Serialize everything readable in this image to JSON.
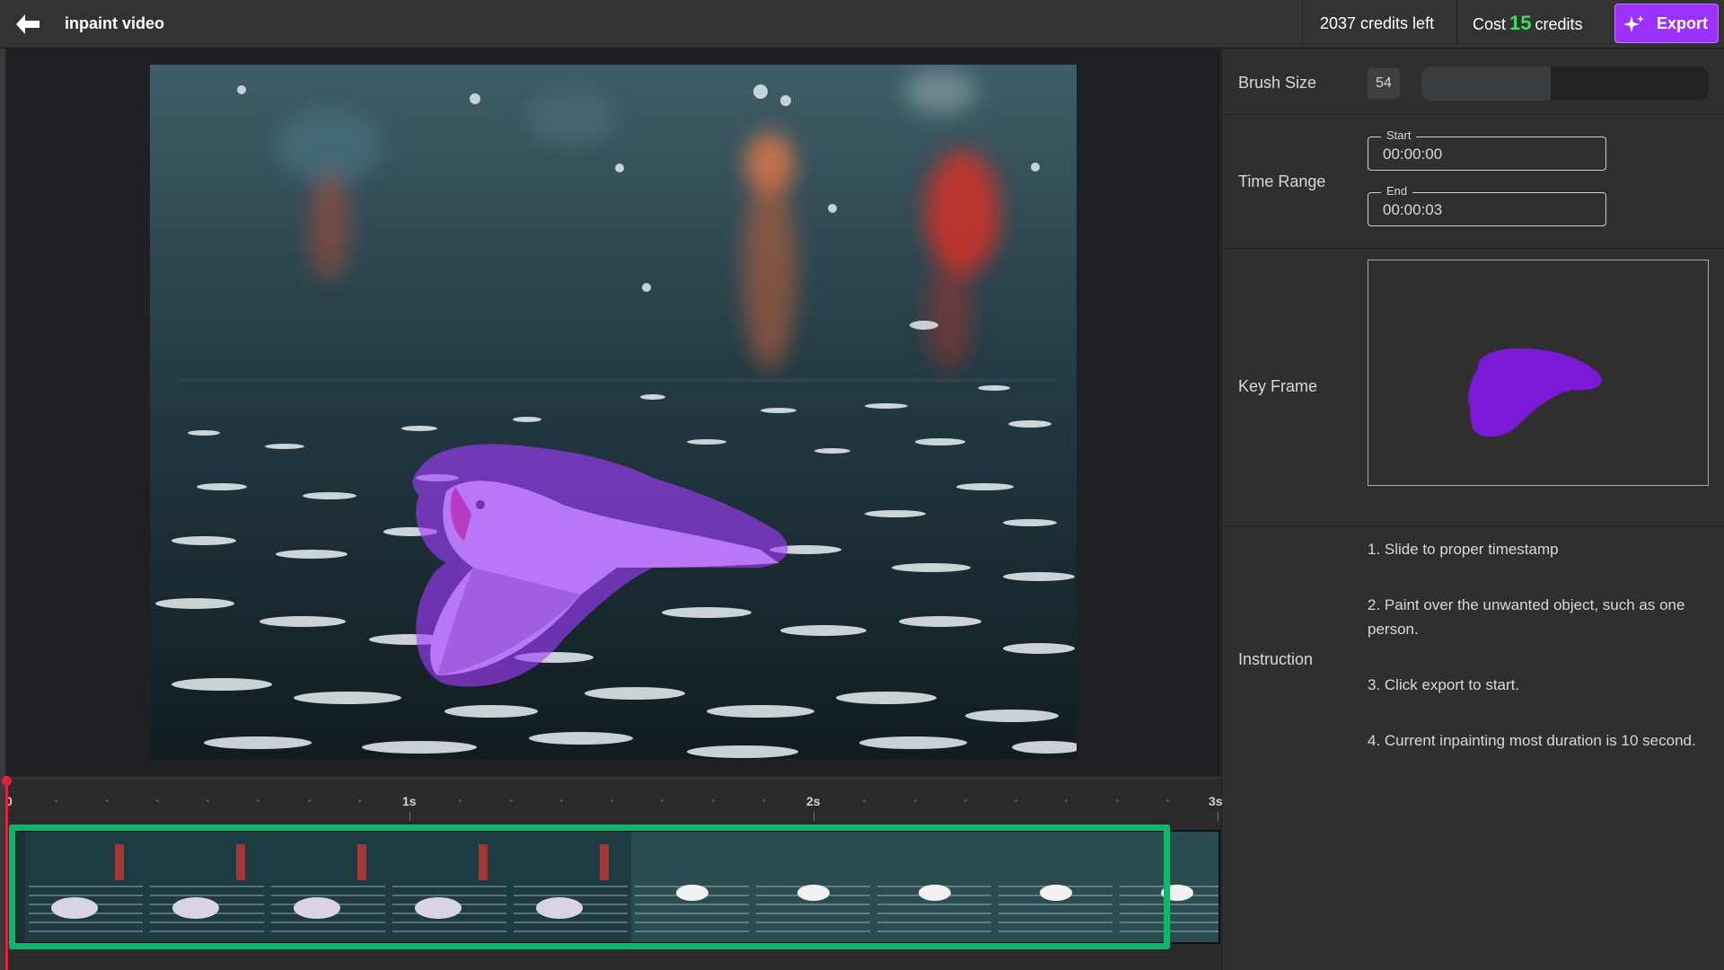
{
  "header": {
    "title": "inpaint video",
    "credits_left": "2037 credits left",
    "cost_prefix": "Cost",
    "cost_value": "15",
    "cost_suffix": "credits",
    "export_label": "Export"
  },
  "panel": {
    "brush_size_label": "Brush Size",
    "brush_size_value": "54",
    "brush_size_fraction": 0.45,
    "time_range_label": "Time Range",
    "start_legend": "Start",
    "start_value": "00:00:00",
    "end_legend": "End",
    "end_value": "00:00:03",
    "key_frame_label": "Key Frame",
    "instruction_label": "Instruction",
    "instructions": [
      "1. Slide to proper timestamp",
      "2. Paint over the unwanted object, such as one person.",
      "3. Click export to start.",
      "4. Current inpainting most duration is 10 second."
    ]
  },
  "timeline": {
    "ticks": [
      "0",
      "1s",
      "2s",
      "3s"
    ],
    "playhead_seconds": 0,
    "selection_end_seconds": 2.8
  },
  "colors": {
    "accent": "#9b30ff",
    "cost_number": "#3fe05f",
    "selection": "#12b36a",
    "playhead": "#e02040",
    "mask": "#a33bff"
  }
}
